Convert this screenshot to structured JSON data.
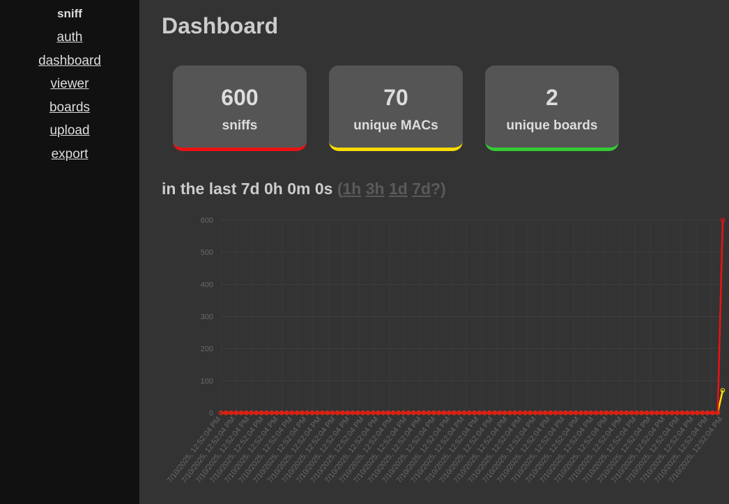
{
  "sidebar": {
    "brand": "sniff",
    "links": [
      "auth",
      "dashboard",
      "viewer",
      "boards",
      "upload",
      "export"
    ]
  },
  "page": {
    "title": "Dashboard"
  },
  "stats": [
    {
      "value": "600",
      "label": "sniffs",
      "color": "#ee1111"
    },
    {
      "value": "70",
      "label": "unique MACs",
      "color": "#ffdd00"
    },
    {
      "value": "2",
      "label": "unique boards",
      "color": "#33cc33"
    }
  ],
  "range": {
    "prefix": "in the last 7d 0h 0m 0s",
    "open": "(",
    "options": [
      "1h",
      "3h",
      "1d",
      "7d"
    ],
    "close": "?)"
  },
  "chart_data": {
    "type": "line",
    "ylim": [
      0,
      600
    ],
    "y_ticks": [
      0,
      100,
      200,
      300,
      400,
      500,
      600
    ],
    "x_tick_label": "7/10/2025, 12:52:04 PM",
    "point_count": 100,
    "grid": true,
    "series": [
      {
        "color": "#ffdd00",
        "last_value": 70
      },
      {
        "color": "#ee1111",
        "last_value": 600
      }
    ]
  }
}
